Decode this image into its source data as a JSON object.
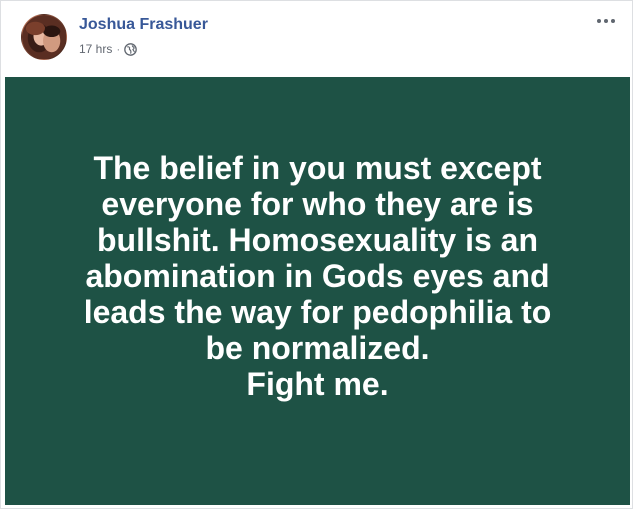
{
  "post": {
    "author": "Joshua Frashuer",
    "timestamp": "17 hrs",
    "separator": "·",
    "privacy_icon": "globe-icon",
    "more_icon": "more-options-icon",
    "text": "The belief in you must except\neveryone for who they are is\nbullshit. Homosexuality is an\nabomination in Gods eyes and\nleads the way for pedophilia to\nbe normalized.\nFight me.",
    "background_color": "#1e5245",
    "text_color": "#ffffff",
    "author_color": "#385898"
  }
}
